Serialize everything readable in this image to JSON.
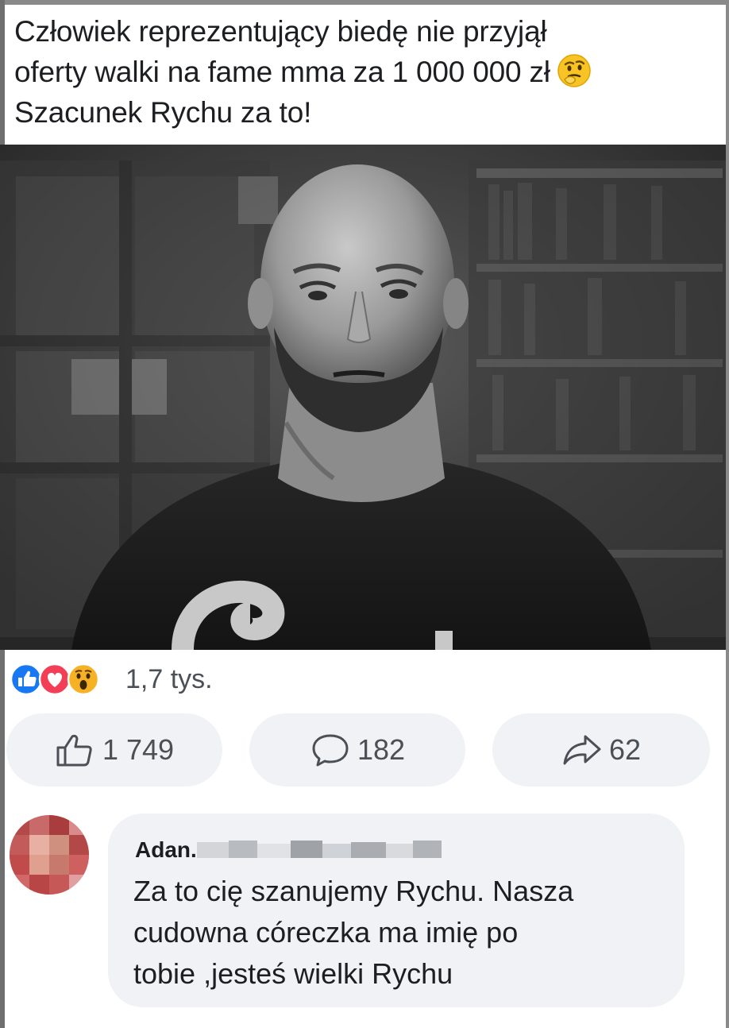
{
  "post": {
    "text_lines": [
      "Człowiek reprezentujący biedę nie przyjął",
      "oferty walki na fame mma za 1 000 000 zł",
      "Szacunek Rychu za to!"
    ],
    "emoji": "thinking-face"
  },
  "photo": {
    "description_icon": "man-portrait-photo"
  },
  "reactions": {
    "icons": [
      "like-reaction",
      "love-reaction",
      "wow-reaction"
    ],
    "count": "1,7 tys."
  },
  "actions": {
    "like_count": "1 749",
    "comment_count": "182",
    "share_count": "62"
  },
  "comment": {
    "author_visible": "Adan...",
    "text_lines": [
      "Za to cię szanujemy Rychu. Nasza",
      "cudowna córeczka ma imię po",
      "tobie ,jesteś wielki Rychu"
    ]
  },
  "colors": {
    "like_blue": "#1877f2",
    "love_red": "#f33e58",
    "wow_yellow": "#f7b125",
    "bubble_gray": "#f0f2f5",
    "text_dark": "#1c1e21",
    "text_secondary": "#4b4f56"
  }
}
